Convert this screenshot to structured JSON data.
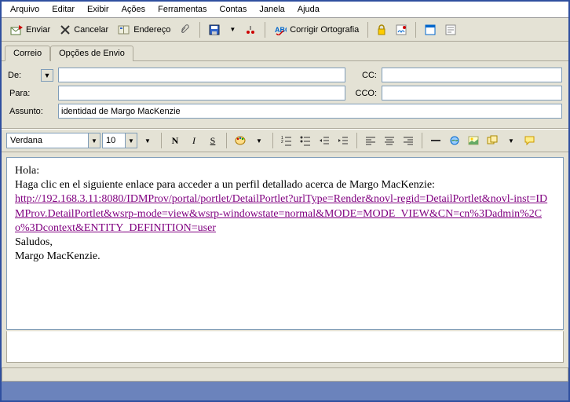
{
  "menu": {
    "arquivo": "Arquivo",
    "editar": "Editar",
    "exibir": "Exibir",
    "acoes": "Ações",
    "ferramentas": "Ferramentas",
    "contas": "Contas",
    "janela": "Janela",
    "ajuda": "Ajuda"
  },
  "toolbar": {
    "enviar": "Enviar",
    "cancelar": "Cancelar",
    "endereco": "Endereço",
    "corrigir": "Corrigir Ortografia"
  },
  "tabs": {
    "correio": "Correio",
    "opcoes": "Opções de Envio"
  },
  "fields": {
    "de": "De:",
    "para": "Para:",
    "assunto": "Assunto:",
    "cc": "CC:",
    "cco": "CCO:"
  },
  "values": {
    "de": "",
    "para": "",
    "cc": "",
    "cco": "",
    "assunto": "identidad de Margo MacKenzie"
  },
  "format": {
    "font": "Verdana",
    "size": "10"
  },
  "body": {
    "greeting": "Hola:",
    "intro": "Haga clic en el siguiente enlace para acceder a un perfil detallado acerca de Margo MacKenzie:",
    "link": "http://192.168.3.11:8080/IDMProv/portal/portlet/DetailPortlet?urlType=Render&novl-regid=DetailPortlet&novl-inst=IDMProv.DetailPortlet&wsrp-mode=view&wsrp-windowstate=normal&MODE=MODE_VIEW&CN=cn%3Dadmin%2Co%3Dcontext&ENTITY_DEFINITION=user",
    "signoff1": "Saludos,",
    "signoff2": "Margo MacKenzie."
  }
}
